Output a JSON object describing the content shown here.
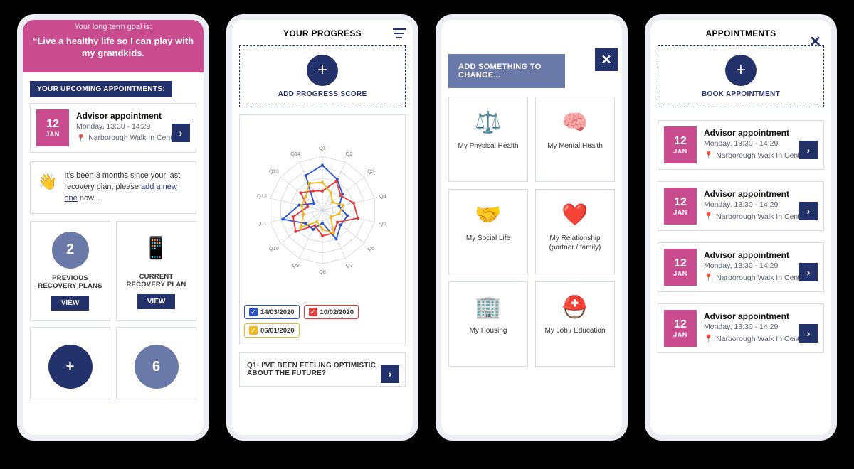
{
  "colors": {
    "navy": "#23326a",
    "pink": "#c94c8f",
    "slate": "#6b79a8"
  },
  "screen1": {
    "goal_lead": "Your long term goal is:",
    "goal_quote": "“Live a healthy life so I can play with my grandkids.",
    "upcoming_label": "YOUR UPCOMING APPOINTMENTS:",
    "appt": {
      "day": "12",
      "month": "JAN",
      "title": "Advisor appointment",
      "time": "Monday, 13:30 - 14:29",
      "location": "Narborough Walk In Centre"
    },
    "note_prefix": "It's been 3 months since your last recovery plan, please ",
    "note_link": "add a new one",
    "note_suffix": " now...",
    "cards": {
      "prev": {
        "count": "2",
        "label": "PREVIOUS RECOVERY PLANS",
        "button": "VIEW"
      },
      "current": {
        "label": "CURRENT RECOVERY PLAN",
        "button": "VIEW"
      },
      "six": {
        "count": "6"
      },
      "add": {
        "plus": "+"
      }
    }
  },
  "screen2": {
    "title": "YOUR PROGRESS",
    "add_label": "ADD PROGRESS SCORE",
    "chips": [
      {
        "date": "14/03/2020",
        "color": "#2a55c9"
      },
      {
        "date": "10/02/2020",
        "color": "#e23b3b"
      },
      {
        "date": "06/01/2020",
        "color": "#f0b81f"
      }
    ],
    "question": "Q1: I'VE BEEN FEELING OPTIMISTIC ABOUT THE FUTURE?"
  },
  "chart_data": {
    "type": "radar",
    "categories": [
      "Q1",
      "Q2",
      "Q3",
      "Q4",
      "Q5",
      "Q6",
      "Q7",
      "Q8",
      "Q9",
      "Q10",
      "Q11",
      "Q12",
      "Q13",
      "Q14"
    ],
    "rmax": 5,
    "series": [
      {
        "name": "14/03/2020",
        "color": "#2a55c9",
        "values": [
          4.2,
          3.2,
          2.4,
          1.6,
          2.4,
          2.2,
          3.0,
          1.2,
          2.0,
          2.0,
          3.8,
          2.2,
          1.0,
          3.6
        ]
      },
      {
        "name": "10/02/2020",
        "color": "#e23b3b",
        "values": [
          1.8,
          3.0,
          2.2,
          3.0,
          3.4,
          1.8,
          2.4,
          2.4,
          1.6,
          3.2,
          2.8,
          1.4,
          2.6,
          2.0
        ]
      },
      {
        "name": "06/01/2020",
        "color": "#f0b81f",
        "values": [
          2.6,
          1.8,
          1.2,
          2.0,
          1.6,
          1.0,
          2.4,
          1.8,
          1.2,
          2.6,
          1.8,
          2.0,
          2.0,
          2.8
        ]
      }
    ]
  },
  "screen3": {
    "banner": "ADD SOMETHING TO CHANGE...",
    "cats": [
      {
        "icon": "⚖️",
        "label": "My Physical Health"
      },
      {
        "icon": "🧠",
        "label": "My Mental Health"
      },
      {
        "icon": "🤝",
        "label": "My Social Life"
      },
      {
        "icon": "❤️",
        "label": "My Relationship (partner / family)"
      },
      {
        "icon": "🏢",
        "label": "My Housing"
      },
      {
        "icon": "⛑️",
        "label": "My Job / Education"
      }
    ]
  },
  "screen4": {
    "title": "APPOINTMENTS",
    "add_label": "BOOK APPOINTMENT",
    "appts": [
      {
        "day": "12",
        "month": "JAN",
        "title": "Advisor appointment",
        "time": "Monday, 13:30 - 14:29",
        "location": "Narborough Walk In Centre"
      },
      {
        "day": "12",
        "month": "JAN",
        "title": "Advisor appointment",
        "time": "Monday, 13:30 - 14:29",
        "location": "Narborough Walk In Centre"
      },
      {
        "day": "12",
        "month": "JAN",
        "title": "Advisor appointment",
        "time": "Monday, 13:30 - 14:29",
        "location": "Narborough Walk In Centre"
      },
      {
        "day": "12",
        "month": "JAN",
        "title": "Advisor appointment",
        "time": "Monday, 13:30 - 14:29",
        "location": "Narborough Walk In Centre"
      }
    ]
  }
}
